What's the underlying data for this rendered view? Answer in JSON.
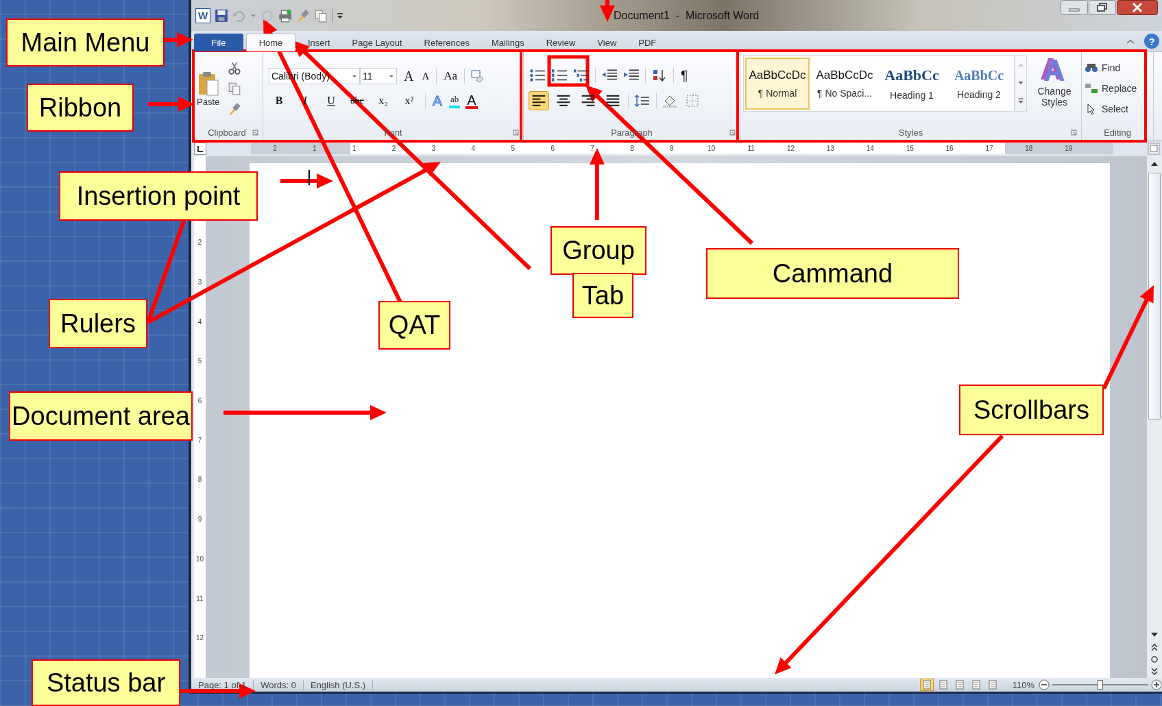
{
  "window": {
    "logo": "W",
    "title": "Document1  -  Microsoft Word",
    "help": "?"
  },
  "tabs": [
    {
      "label": "File",
      "selected": false,
      "kind": "file"
    },
    {
      "label": "Home",
      "selected": true,
      "kind": "tab"
    },
    {
      "label": "Insert",
      "selected": false,
      "kind": "tab"
    },
    {
      "label": "Page Layout",
      "selected": false,
      "kind": "tab"
    },
    {
      "label": "References",
      "selected": false,
      "kind": "tab"
    },
    {
      "label": "Mailings",
      "selected": false,
      "kind": "tab"
    },
    {
      "label": "Review",
      "selected": false,
      "kind": "tab"
    },
    {
      "label": "View",
      "selected": false,
      "kind": "tab"
    },
    {
      "label": "PDF",
      "selected": false,
      "kind": "tab"
    }
  ],
  "ribbon": {
    "clipboard": {
      "paste": "Paste",
      "label": "Clipboard"
    },
    "font": {
      "name": "Calibri (Body)",
      "size": "11",
      "grow": "A",
      "shrink": "A",
      "change_case": "Aa",
      "row2": [
        "B",
        "I",
        "U",
        "abc",
        "x₂",
        "x²"
      ],
      "effects": "A",
      "highlight": "ab",
      "font_color_button": "A",
      "label": "Font"
    },
    "paragraph": {
      "alignment": [
        {
          "selected": true
        },
        {
          "selected": false
        },
        {
          "selected": false
        },
        {
          "selected": false
        }
      ],
      "marks": "¶",
      "label": "Paragraph"
    },
    "styles": {
      "items": [
        {
          "preview": "AaBbCcDc",
          "name": "¶ Normal",
          "selected": true,
          "kind": "normal"
        },
        {
          "preview": "AaBbCcDc",
          "name": "¶ No Spaci...",
          "selected": false,
          "kind": "normal"
        },
        {
          "preview": "AaBbCc",
          "name": "Heading 1",
          "selected": false,
          "kind": "heading1"
        },
        {
          "preview": "AaBbCc",
          "name": "Heading 2",
          "selected": false,
          "kind": "heading2"
        }
      ],
      "art": "A",
      "change_styles": "Change Styles",
      "label": "Styles"
    },
    "editing": {
      "items": [
        {
          "label": "Find",
          "kind": "find"
        },
        {
          "label": "Replace",
          "kind": "replace"
        },
        {
          "label": "Select",
          "kind": "select"
        }
      ],
      "label": "Editing"
    }
  },
  "ruler": {
    "horizontal": [
      "2",
      "1",
      "1",
      "2",
      "3",
      "4",
      "5",
      "6",
      "7",
      "8",
      "9",
      "10",
      "11",
      "12",
      "13",
      "14",
      "15",
      "16",
      "17",
      "18",
      "19"
    ],
    "vertical": [
      "2",
      "3",
      "4",
      "5",
      "6",
      "7",
      "8",
      "9",
      "10",
      "11",
      "12"
    ]
  },
  "status_bar": {
    "items": [
      "Page: 1 of 1",
      "Words: 0",
      "English (U.S.)"
    ],
    "views": [
      {
        "selected": true
      },
      {
        "selected": false
      },
      {
        "selected": false
      },
      {
        "selected": false
      },
      {
        "selected": false
      }
    ],
    "zoom": "110%",
    "zoom_slider": {
      "level": 0.5
    }
  },
  "annotations": [
    {
      "label": "Main Menu"
    },
    {
      "label": "Ribbon"
    },
    {
      "label": "Insertion point"
    },
    {
      "label": "Rulers"
    },
    {
      "label": "Document area"
    },
    {
      "label": "Status bar"
    },
    {
      "label": "QAT"
    },
    {
      "label": "Group"
    },
    {
      "label": "Tab"
    },
    {
      "label": "Cammand"
    },
    {
      "label": "Scrollbars"
    }
  ]
}
